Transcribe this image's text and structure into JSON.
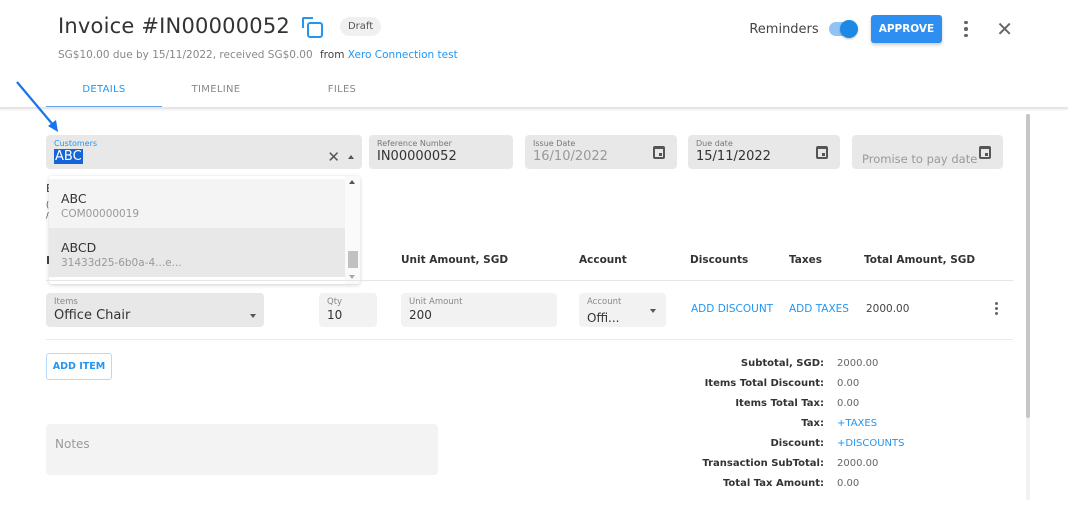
{
  "header": {
    "title": "Invoice #IN00000052",
    "status_badge": "Draft",
    "subline": "SG$10.00 due by 15/11/2022, received SG$0.00",
    "from_label": "from",
    "from_link": "Xero Connection test",
    "reminders_label": "Reminders",
    "reminders_on": true,
    "approve_label": "APPROVE"
  },
  "tabs": [
    {
      "label": "DETAILS",
      "active": true
    },
    {
      "label": "TIMELINE",
      "active": false
    },
    {
      "label": "FILES",
      "active": false
    }
  ],
  "fields": {
    "customers": {
      "label": "Customers",
      "value": "ABC"
    },
    "reference": {
      "label": "Reference Number",
      "value": "IN00000052"
    },
    "issue_date": {
      "label": "Issue Date",
      "value": "16/10/2022"
    },
    "due_date": {
      "label": "Due date",
      "value": "15/11/2022"
    },
    "promise_date": {
      "placeholder": "Promise to pay date"
    }
  },
  "customer_dropdown": {
    "options": [
      {
        "name": "ABC",
        "sub": "COM00000019"
      },
      {
        "name": "ABCD",
        "sub": "31433d25-6b0a-4...e..."
      }
    ]
  },
  "table": {
    "headers": [
      "Unit Amount, SGD",
      "Account",
      "Discounts",
      "Taxes",
      "Total Amount, SGD"
    ],
    "rows": [
      {
        "item_label": "Items",
        "item": "Office Chair",
        "qty_label": "Qty",
        "qty": "10",
        "unit_label": "Unit Amount",
        "unit": "200",
        "account_label": "Account",
        "account": "Offi...",
        "discount_action": "ADD DISCOUNT",
        "tax_action": "ADD TAXES",
        "total": "2000.00"
      }
    ]
  },
  "add_item_label": "ADD ITEM",
  "notes_placeholder": "Notes",
  "summary": [
    {
      "label": "Subtotal, SGD:",
      "value": "2000.00",
      "link": false
    },
    {
      "label": "Items Total Discount:",
      "value": "0.00",
      "link": false
    },
    {
      "label": "Items Total Tax:",
      "value": "0.00",
      "link": false
    },
    {
      "label": "Tax:",
      "value": "+TAXES",
      "link": true
    },
    {
      "label": "Discount:",
      "value": "+DISCOUNTS",
      "link": true
    },
    {
      "label": "Transaction SubTotal:",
      "value": "2000.00",
      "link": false
    },
    {
      "label": "Total Tax Amount:",
      "value": "0.00",
      "link": false
    }
  ]
}
